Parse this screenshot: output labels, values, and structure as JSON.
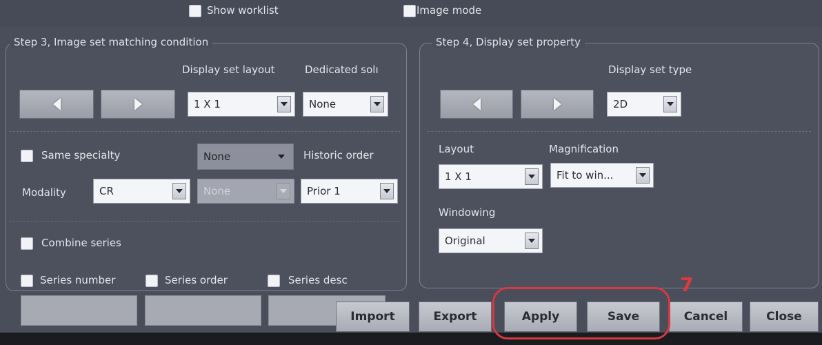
{
  "top": {
    "show_worklist": "Show worklist",
    "image_mode": "Image mode"
  },
  "step3": {
    "title": "Step 3, Image set matching condition",
    "display_set_layout_label": "Display set layout",
    "dedicated_label": "Dedicated solı",
    "display_set_layout_value": "1 X 1",
    "dedicated_value": "None",
    "same_specialty_label": "Same specialty",
    "same_specialty_value": "None",
    "historic_order_label": "Historic order",
    "modality_label": "Modality",
    "modality_value": "CR",
    "modality_second_value": "None",
    "historic_order_value": "Prior 1",
    "combine_series_label": "Combine series",
    "series_number_label": "Series number",
    "series_order_label": "Series order",
    "series_desc_label": "Series desc"
  },
  "step4": {
    "title": "Step 4, Display set property",
    "display_set_type_label": "Display set type",
    "display_set_type_value": "2D",
    "layout_label": "Layout",
    "layout_value": "1 X 1",
    "magnification_label": "Magnification",
    "magnification_value": "Fit to win...",
    "windowing_label": "Windowing",
    "windowing_value": "Original"
  },
  "buttons": {
    "import": "Import",
    "export": "Export",
    "apply": "Apply",
    "save": "Save",
    "cancel": "Cancel",
    "close": "Close"
  },
  "annotation": {
    "number": "7",
    "color": "#d8383f"
  }
}
